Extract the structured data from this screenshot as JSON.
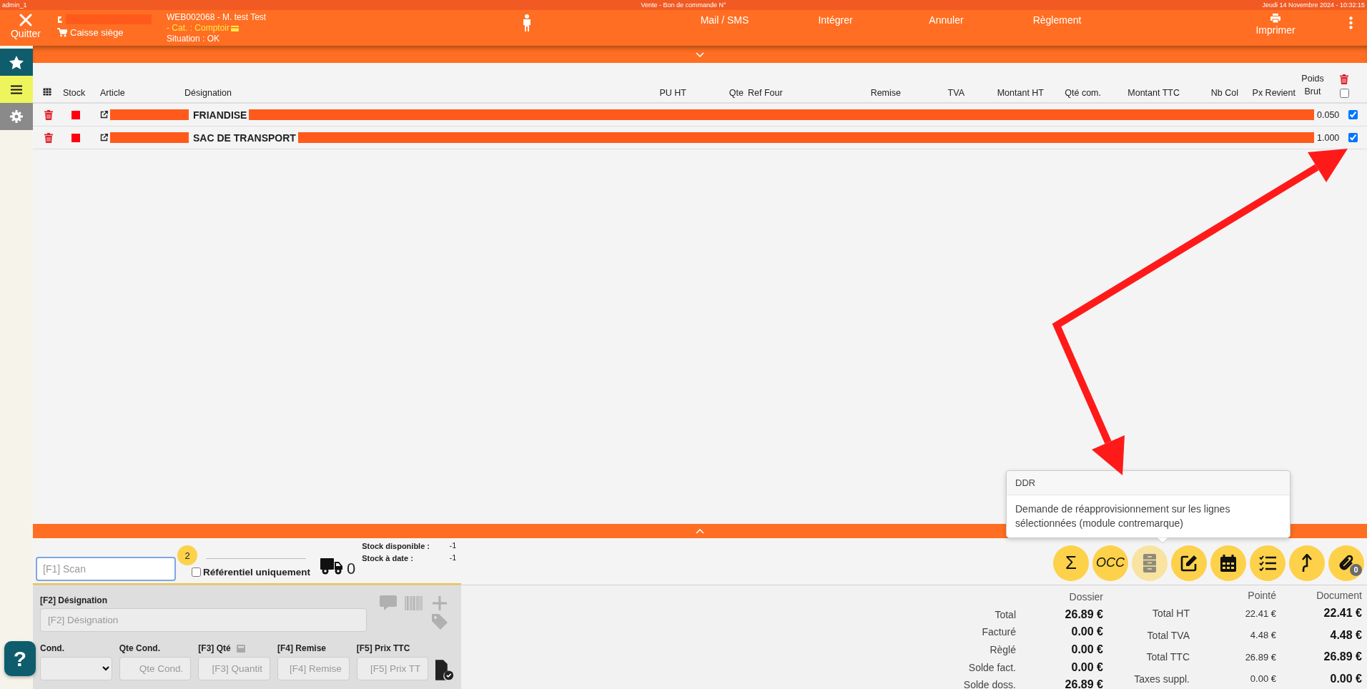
{
  "top_bar": {
    "user": "admin_1",
    "title": "Vente - Bon de commande N°",
    "datetime": "Jeudi 14 Novembre 2024 - 10:32:15"
  },
  "header": {
    "quit_label": "Quitter",
    "store": "Caisse siège",
    "document": "WEB002068 - M. test Test",
    "category": "- Cat. : Comptoir",
    "situation": "Situation : OK",
    "actions": [
      "Mail / SMS",
      "Intégrer",
      "Annuler",
      "Règlement"
    ],
    "print_label": "Imprimer"
  },
  "sidebar": {
    "items": [
      {
        "kind": "favorites",
        "selected": false
      },
      {
        "kind": "menu",
        "selected": true
      },
      {
        "kind": "settings",
        "selected": false
      }
    ]
  },
  "table": {
    "columns": [
      "Stock",
      "Article",
      "Désignation",
      "PU HT",
      "Qte",
      "Ref Four",
      "Remise",
      "TVA",
      "Montant HT",
      "Qté com.",
      "Montant TTC",
      "Nb Col",
      "Px Revient",
      "Poids Brut"
    ],
    "select_all_checked": false,
    "rows": [
      {
        "designation": "FRIANDISE",
        "weight": "0.050",
        "checked": true
      },
      {
        "designation": "SAC DE TRANSPORT",
        "weight": "1.000",
        "checked": true
      }
    ]
  },
  "tooltip": {
    "title": "DDR",
    "text": "Demande de réapprovisionnement sur les lignes sélectionnées (module contremarque)"
  },
  "entry": {
    "scan_placeholder": "[F1] Scan",
    "badge": "2",
    "referentiel_label": "Référentiel uniquement",
    "referentiel_checked": false,
    "delivery_count": "0",
    "stock_available_label": "Stock disponible :",
    "stock_available": "-1",
    "stock_date_label": "Stock à date :",
    "stock_date": "-1"
  },
  "actions": [
    {
      "kind": "sum",
      "label": "Σ",
      "disabled": false
    },
    {
      "kind": "occ",
      "label": "OCC",
      "disabled": false
    },
    {
      "kind": "ddr",
      "disabled": true
    },
    {
      "kind": "edit",
      "disabled": false
    },
    {
      "kind": "calendar",
      "disabled": false
    },
    {
      "kind": "checklist",
      "disabled": false
    },
    {
      "kind": "export",
      "disabled": false
    },
    {
      "kind": "attach",
      "badge": "0",
      "disabled": false
    }
  ],
  "form": {
    "designation_label": "[F2] Désignation",
    "designation_placeholder": "[F2] Désignation",
    "fields": [
      {
        "kind": "select",
        "label": "Cond."
      },
      {
        "kind": "input",
        "label": "Qte Cond.",
        "placeholder": "Qte Cond."
      },
      {
        "kind": "input",
        "label": "[F3] Qté",
        "placeholder": "[F3] Quantit",
        "has_calculator": true
      },
      {
        "kind": "input",
        "label": "[F4] Remise",
        "placeholder": "[F4] Remise"
      },
      {
        "kind": "input",
        "label": "[F5] Prix TTC",
        "placeholder": "[F5] Prix TT"
      }
    ]
  },
  "totals": {
    "dossier_heading": "Dossier",
    "dossier_rows": [
      {
        "label": "Total",
        "value": "26.89 €"
      },
      {
        "label": "Facturé",
        "value": "0.00 €"
      },
      {
        "label": "Règlé",
        "value": "0.00 €"
      },
      {
        "label": "Solde fact.",
        "value": "0.00 €"
      },
      {
        "label": "Solde doss.",
        "value": "26.89 €"
      }
    ],
    "pointed_heading": "Pointé",
    "document_heading": "Document",
    "document_rows": [
      {
        "label": "Total HT",
        "pointed": "22.41 €",
        "value": "22.41 €"
      },
      {
        "label": "Total TVA",
        "pointed": "4.48 €",
        "value": "4.48 €"
      },
      {
        "label": "Total TTC",
        "pointed": "26.89 €",
        "value": "26.89 €"
      },
      {
        "label": "Taxes suppl.",
        "pointed": "0.00 €",
        "value": "0.00 €"
      }
    ]
  },
  "help_label": "?"
}
